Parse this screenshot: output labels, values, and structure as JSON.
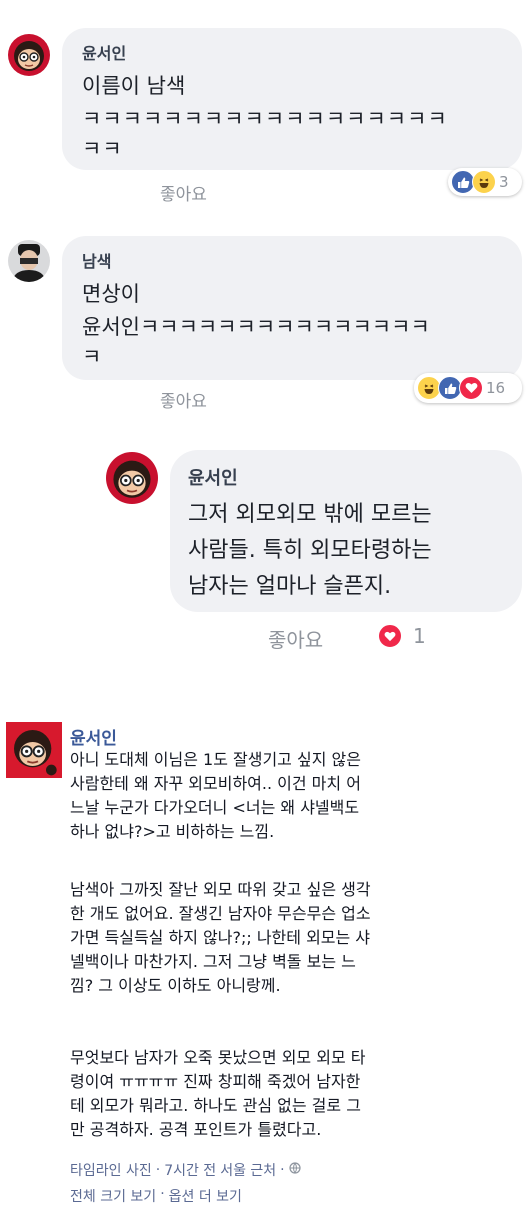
{
  "comment1": {
    "name": "윤서인",
    "line1": "이름이 남색",
    "line2": "ㅋㅋㅋㅋㅋㅋㅋㅋㅋㅋㅋㅋㅋㅋㅋㅋㅋㅋ",
    "line3": "ㅋㅋ",
    "like_label": "좋아요",
    "reaction_count": "3",
    "reaction_icons": [
      "like-icon",
      "haha-icon"
    ]
  },
  "comment2": {
    "name": "남색",
    "line1": "면상이",
    "line2": "윤서인ㅋㅋㅋㅋㅋㅋㅋㅋㅋㅋㅋㅋㅋㅋㅋ",
    "line3": "ㅋ",
    "like_label": "좋아요",
    "reaction_count": "16",
    "reaction_icons": [
      "haha-icon",
      "like-icon",
      "love-icon"
    ]
  },
  "reply": {
    "name": "윤서인",
    "line1": "그저 외모외모 밖에 모르는",
    "line2": "사람들. 특히 외모타령하는",
    "line3": "남자는 얼마나 슬픈지.",
    "like_label": "좋아요",
    "reaction_count": "1",
    "reaction_icons": [
      "love-icon"
    ]
  },
  "post": {
    "name": "윤서인",
    "para1": "아니 도대체 이님은 1도 잘생기고 싶지 않은\n사람한테 왜 자꾸 외모비하여.. 이건 마치 어\n느날 누군가 다가오더니 <너는 왜 샤넬백도\n하나 없냐?>고 비하하는 느낌.",
    "para2": "남색아 그까짓 잘난 외모 따위 갖고 싶은 생각\n한 개도 없어요. 잘생긴 남자야 무슨무슨 업소\n가면 득실득실 하지 않나?;; 나한테 외모는 샤\n넬백이나 마찬가지. 그저 그냥 벽돌 보는 느\n낌? 그 이상도 이하도 아니랑께.",
    "para3": "무엇보다 남자가 오죽 못났으면 외모 외모 타\n령이여 ㅠㅠㅠㅠ 진짜 창피해 죽겠어 남자한\n테 외모가 뭐라고. 하나도 관심 없는 걸로 그\n만 공격하자. 공격 포인트가 틀렸다고.",
    "meta": {
      "album": "타임라인 사진",
      "time": "7시간 전",
      "location": "서울 근처",
      "sep": "·",
      "privacy_icon": "globe-icon"
    },
    "actions": {
      "full_size": "전체 크기 보기",
      "more_options": "옵션 더 보기",
      "sep": "·"
    }
  },
  "colors": {
    "bubble_bg": "#f0f1f4",
    "like_blue": "#4267b2",
    "love_red": "#f0284a",
    "haha_yellow": "#fcd24c",
    "link_blue": "#3b5998"
  }
}
